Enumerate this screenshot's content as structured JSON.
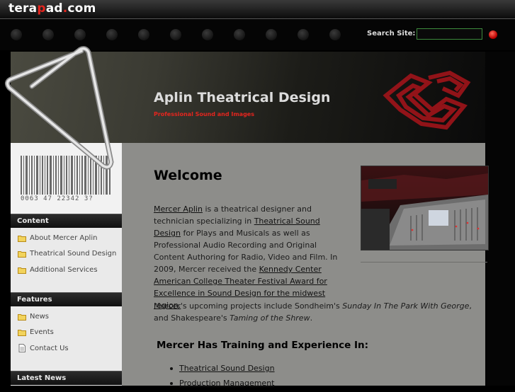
{
  "topbar": {
    "logo_prefix": "tera",
    "logo_p": "p",
    "logo_suffix": "ad",
    "logo_dot": ".",
    "logo_tld": "com"
  },
  "search": {
    "label": "Search Site:",
    "value": "",
    "placeholder": ""
  },
  "header": {
    "title": "Aplin Theatrical Design",
    "subtitle": "Professional Sound and Images"
  },
  "barcode": {
    "number": "0063 47 22342 3?"
  },
  "sidebar": {
    "content_title": "Content",
    "content_items": [
      {
        "label": "About Mercer Aplin",
        "icon": "folder-icon"
      },
      {
        "label": "Theatrical Sound Design",
        "icon": "folder-icon"
      },
      {
        "label": "Additional Services",
        "icon": "folder-icon"
      }
    ],
    "features_title": "Features",
    "features_items": [
      {
        "label": "News",
        "icon": "folder-icon"
      },
      {
        "label": "Events",
        "icon": "folder-icon"
      },
      {
        "label": "Contact Us",
        "icon": "document-icon"
      }
    ],
    "latest_title": "Latest News"
  },
  "main": {
    "heading": "Welcome",
    "intro": {
      "link1": "Mercer Aplin",
      "t1": " is a theatrical designer and technician specializing in ",
      "link2": "Theatrical Sound Design",
      "t2": " for Plays and Musicals as well as Professional Audio Recording and Original Content Authoring for Radio, Video and Film. In 2009, Mercer received the ",
      "link3": "Kennedy Center American College Theater Festival Award for Excellence in Sound Design for the midwest region."
    },
    "upcoming": {
      "t1": "Mercer's upcoming projects include Sondheim's ",
      "i1": "Sunday In The Park With George",
      "t2": ", and Shakespeare's ",
      "i2": "Taming of the Shrew",
      "t3": "."
    },
    "training_heading": "Mercer Has Training and Experience In:",
    "training_items": [
      "Theatrical Sound Design",
      "Production Management"
    ]
  },
  "colors": {
    "accent_red": "#e5251e",
    "main_bg": "#8d8d8a",
    "sidebar_bg": "#eaeaea"
  }
}
